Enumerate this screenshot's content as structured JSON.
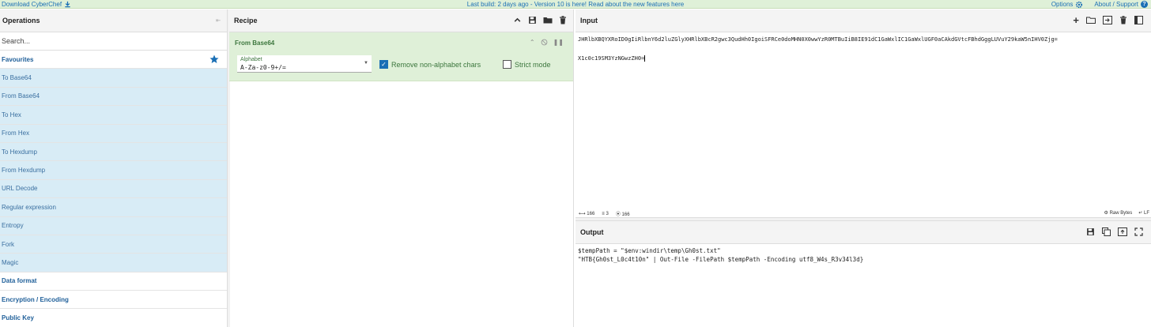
{
  "banner": {
    "download_label": "Download CyberChef",
    "center_text": "Last build: 2 days ago - Version 10 is here! Read about the new features here",
    "options_label": "Options",
    "about_label": "About / Support"
  },
  "operations": {
    "title": "Operations",
    "search_placeholder": "Search...",
    "favourites_label": "Favourites",
    "items": [
      "To Base64",
      "From Base64",
      "To Hex",
      "From Hex",
      "To Hexdump",
      "From Hexdump",
      "URL Decode",
      "Regular expression",
      "Entropy",
      "Fork",
      "Magic"
    ],
    "categories": [
      "Data format",
      "Encryption / Encoding",
      "Public Key"
    ]
  },
  "recipe": {
    "title": "Recipe",
    "operation": {
      "name": "From Base64",
      "alphabet_label": "Alphabet",
      "alphabet_value": "A-Za-z0-9+/=",
      "remove_label": "Remove non-alphabet chars",
      "remove_checked": true,
      "strict_label": "Strict mode",
      "strict_checked": false
    }
  },
  "input": {
    "title": "Input",
    "line1": "JHRlbXBQYXRoID0gIiRlbnY6d2luZGlyXHRlbXBcR2gwc3QudHh0IgoiSFRCe0doMHN0X0wwYzR0MTBuIiB8IE91dC1GaWxlIC1GaWxlUGF0aCAkdGVtcFBhdGggLUVuY29kaW5nIHV0Zjg=",
    "line2": "X1c0c19SM3YzNGwzZH0=",
    "length": "166",
    "lines": "3",
    "position": "166",
    "raw_bytes_label": "Raw Bytes",
    "eol_label": "LF"
  },
  "output": {
    "title": "Output",
    "line1": "$tempPath = \"$env:windir\\temp\\Gh0st.txt\"",
    "line2": "\"HTB{Gh0st_L0c4t10n\" | Out-File -FilePath $tempPath -Encoding utf8_W4s_R3v34l3d}"
  }
}
